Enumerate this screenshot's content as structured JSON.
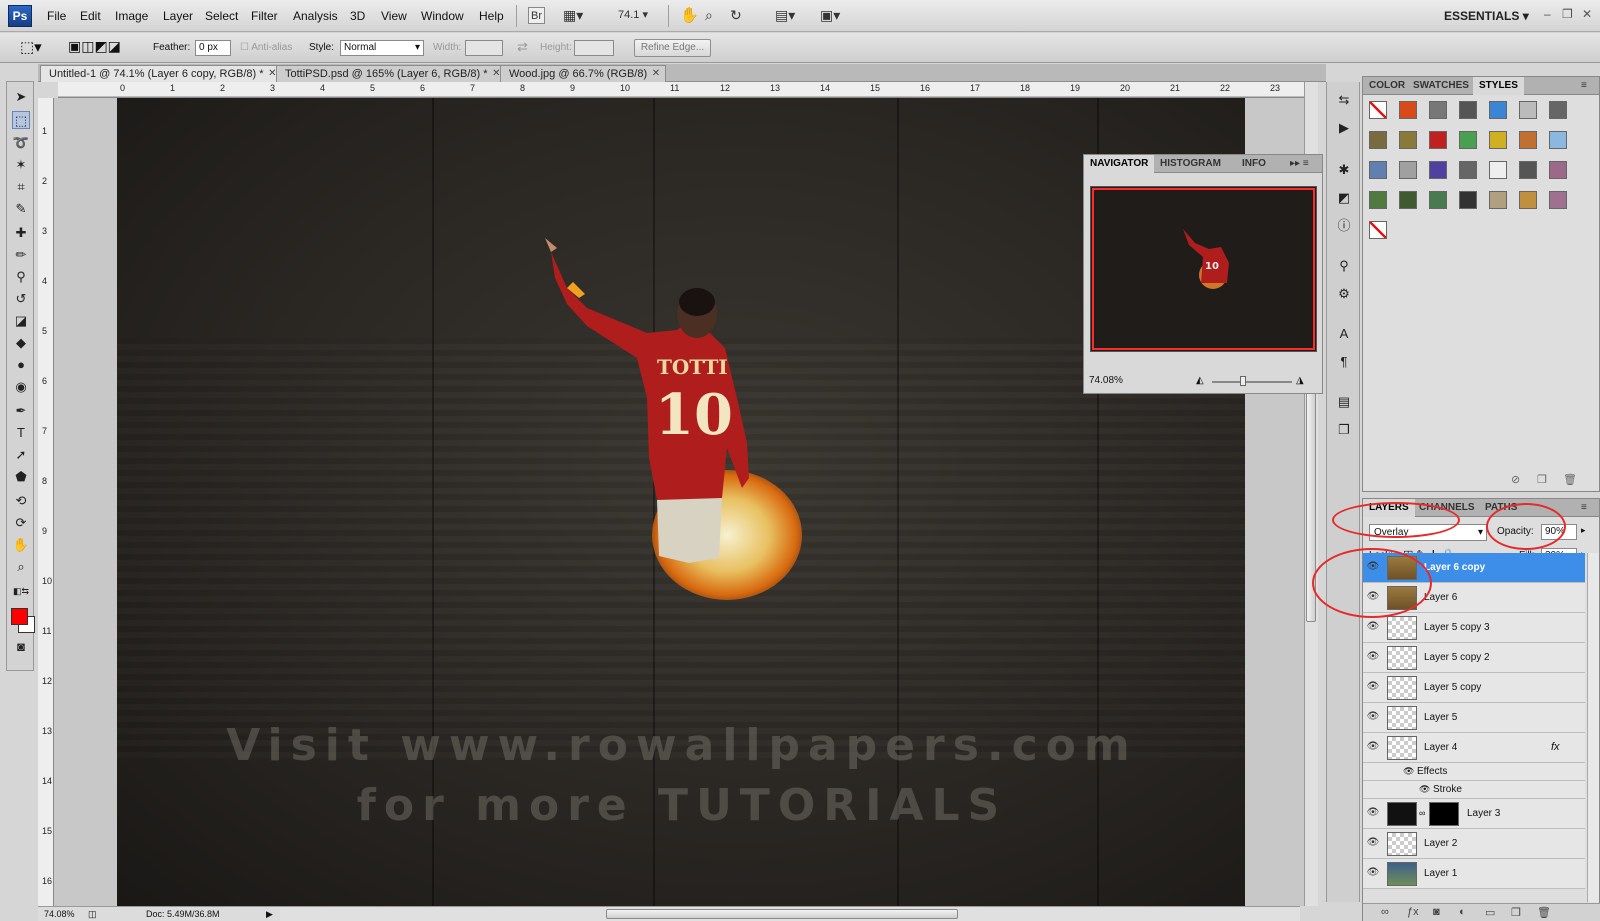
{
  "app": {
    "logo": "Ps",
    "workspace": "ESSENTIALS",
    "zoom_value": "74.1",
    "bridge_label": "Br"
  },
  "menu": [
    "File",
    "Edit",
    "Image",
    "Layer",
    "Select",
    "Filter",
    "Analysis",
    "3D",
    "View",
    "Window",
    "Help"
  ],
  "options": {
    "feather_label": "Feather:",
    "feather_value": "0 px",
    "antialias_label": "Anti-alias",
    "style_label": "Style:",
    "style_value": "Normal",
    "width_label": "Width:",
    "height_label": "Height:",
    "refine_label": "Refine Edge..."
  },
  "tabs": [
    {
      "label": "Untitled-1 @ 74.1% (Layer 6 copy, RGB/8) *"
    },
    {
      "label": "TottiPSD.psd @ 165% (Layer 6, RGB/8) *"
    },
    {
      "label": "Wood.jpg @ 66.7% (RGB/8)"
    }
  ],
  "ruler_top": [
    "0",
    "1",
    "2",
    "3",
    "4",
    "5",
    "6",
    "7",
    "8",
    "9",
    "10",
    "11",
    "12",
    "13",
    "14",
    "15",
    "16",
    "17",
    "18",
    "19",
    "20",
    "21",
    "22",
    "23"
  ],
  "ruler_left": [
    "1",
    "2",
    "3",
    "4",
    "5",
    "6",
    "7",
    "8",
    "9",
    "10",
    "11",
    "12",
    "13",
    "14",
    "15",
    "16"
  ],
  "canvas": {
    "shirt_name": "TOTTI",
    "shirt_number": "10",
    "watermark_line1": "Visit www.rowallpapers.com",
    "watermark_line2": "for more TUTORIALS",
    "fg_color": "#ff0000",
    "bg_color": "#ffffff"
  },
  "status": {
    "zoom": "74.08%",
    "doc": "Doc: 5.49M/36.8M"
  },
  "navigator": {
    "tabs": [
      "NAVIGATOR",
      "HISTOGRAM",
      "INFO"
    ],
    "zoom": "74.08%",
    "thumb_number": "10"
  },
  "styles_panel": {
    "tabs": [
      "COLOR",
      "SWATCHES",
      "STYLES"
    ]
  },
  "layers_panel": {
    "tabs": [
      "LAYERS",
      "CHANNELS",
      "PATHS"
    ],
    "blend_mode": "Overlay",
    "opacity_label": "Opacity:",
    "opacity_value": "90%",
    "lock_label": "Lock:",
    "fill_label": "Fill:",
    "fill_value": "30%",
    "fx_label": "fx",
    "effects_label": "Effects",
    "stroke_label": "Stroke",
    "layers": [
      {
        "name": "Layer 6 copy",
        "thumb": "wood",
        "selected": true
      },
      {
        "name": "Layer 6",
        "thumb": "wood"
      },
      {
        "name": "Layer 5 copy 3",
        "thumb": "trans"
      },
      {
        "name": "Layer 5 copy 2",
        "thumb": "trans"
      },
      {
        "name": "Layer 5 copy",
        "thumb": "trans"
      },
      {
        "name": "Layer 5",
        "thumb": "trans"
      },
      {
        "name": "Layer 4",
        "thumb": "trans"
      },
      {
        "name": "Layer 3",
        "thumb": "dark"
      },
      {
        "name": "Layer 2",
        "thumb": "trans"
      },
      {
        "name": "Layer 1",
        "thumb": "photo"
      }
    ]
  }
}
